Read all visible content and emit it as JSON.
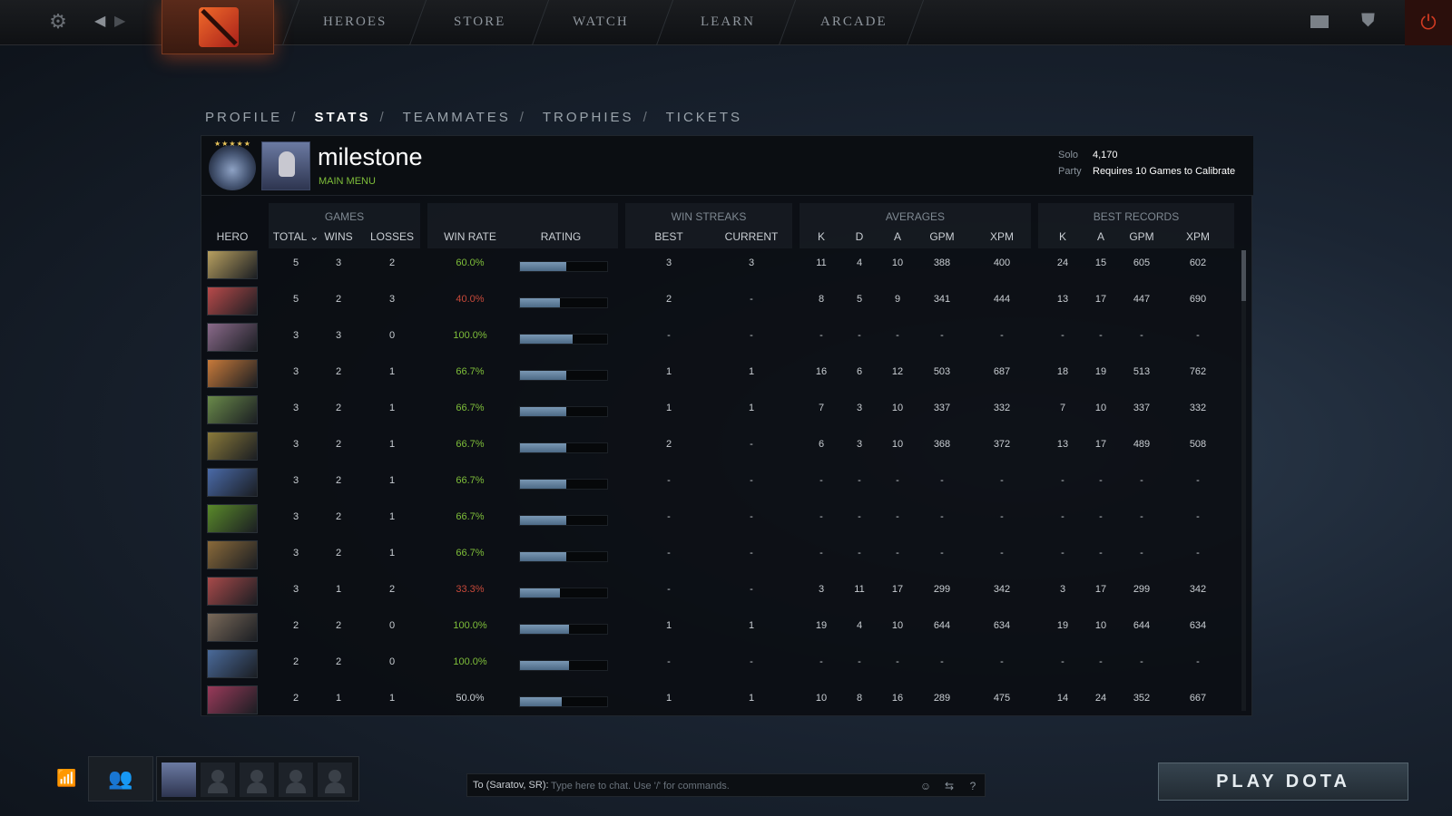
{
  "topbar": {
    "nav": [
      "HEROES",
      "STORE",
      "WATCH",
      "LEARN",
      "ARCADE"
    ],
    "icons": [
      "settings-gear-icon",
      "back-arrow-icon",
      "forward-arrow-icon",
      "mail-icon",
      "shield-icon",
      "power-icon"
    ]
  },
  "breadcrumb": [
    "PROFILE",
    "STATS",
    "TEAMMATES",
    "TROPHIES",
    "TICKETS"
  ],
  "breadcrumb_active": "STATS",
  "profile": {
    "name": "milestone",
    "subtitle": "MAIN MENU",
    "solo_label": "Solo",
    "solo_value": "4,170",
    "party_label": "Party",
    "party_value": "Requires 10 Games to Calibrate"
  },
  "table": {
    "groups": {
      "games": "GAMES",
      "streaks": "WIN STREAKS",
      "averages": "AVERAGES",
      "best": "BEST RECORDS"
    },
    "columns": {
      "hero": "HERO",
      "total": "TOTAL ⌄",
      "wins": "WINS",
      "losses": "LOSSES",
      "winrate": "WIN RATE",
      "rating": "RATING",
      "best": "BEST",
      "current": "CURRENT",
      "k": "K",
      "d": "D",
      "a": "A",
      "gpm": "GPM",
      "xpm": "XPM",
      "bk": "K",
      "ba": "A",
      "bgpm": "GPM",
      "bxpm": "XPM"
    },
    "rows": [
      {
        "total": "5",
        "wins": "3",
        "losses": "2",
        "winrate": "60.0%",
        "rating": 0.53,
        "best": "3",
        "current": "3",
        "k": "11",
        "d": "4",
        "a": "10",
        "gpm": "388",
        "xpm": "400",
        "bk": "24",
        "ba": "15",
        "bgpm": "605",
        "bxpm": "602",
        "color": "#b8a060"
      },
      {
        "total": "5",
        "wins": "2",
        "losses": "3",
        "winrate": "40.0%",
        "rating": 0.46,
        "best": "2",
        "current": "-",
        "k": "8",
        "d": "5",
        "a": "9",
        "gpm": "341",
        "xpm": "444",
        "bk": "13",
        "ba": "17",
        "bgpm": "447",
        "bxpm": "690",
        "color": "#b84a4a"
      },
      {
        "total": "3",
        "wins": "3",
        "losses": "0",
        "winrate": "100.0%",
        "rating": 0.6,
        "best": "-",
        "current": "-",
        "k": "-",
        "d": "-",
        "a": "-",
        "gpm": "-",
        "xpm": "-",
        "bk": "-",
        "ba": "-",
        "bgpm": "-",
        "bxpm": "-",
        "color": "#8a6a8a"
      },
      {
        "total": "3",
        "wins": "2",
        "losses": "1",
        "winrate": "66.7%",
        "rating": 0.53,
        "best": "1",
        "current": "1",
        "k": "16",
        "d": "6",
        "a": "12",
        "gpm": "503",
        "xpm": "687",
        "bk": "18",
        "ba": "19",
        "bgpm": "513",
        "bxpm": "762",
        "color": "#c87a3a"
      },
      {
        "total": "3",
        "wins": "2",
        "losses": "1",
        "winrate": "66.7%",
        "rating": 0.53,
        "best": "1",
        "current": "1",
        "k": "7",
        "d": "3",
        "a": "10",
        "gpm": "337",
        "xpm": "332",
        "bk": "7",
        "ba": "10",
        "bgpm": "337",
        "bxpm": "332",
        "color": "#6a8a4a"
      },
      {
        "total": "3",
        "wins": "2",
        "losses": "1",
        "winrate": "66.7%",
        "rating": 0.53,
        "best": "2",
        "current": "-",
        "k": "6",
        "d": "3",
        "a": "10",
        "gpm": "368",
        "xpm": "372",
        "bk": "13",
        "ba": "17",
        "bgpm": "489",
        "bxpm": "508",
        "color": "#8a7a3a"
      },
      {
        "total": "3",
        "wins": "2",
        "losses": "1",
        "winrate": "66.7%",
        "rating": 0.53,
        "best": "-",
        "current": "-",
        "k": "-",
        "d": "-",
        "a": "-",
        "gpm": "-",
        "xpm": "-",
        "bk": "-",
        "ba": "-",
        "bgpm": "-",
        "bxpm": "-",
        "color": "#4a6aa8"
      },
      {
        "total": "3",
        "wins": "2",
        "losses": "1",
        "winrate": "66.7%",
        "rating": 0.53,
        "best": "-",
        "current": "-",
        "k": "-",
        "d": "-",
        "a": "-",
        "gpm": "-",
        "xpm": "-",
        "bk": "-",
        "ba": "-",
        "bgpm": "-",
        "bxpm": "-",
        "color": "#5a8a2a"
      },
      {
        "total": "3",
        "wins": "2",
        "losses": "1",
        "winrate": "66.7%",
        "rating": 0.53,
        "best": "-",
        "current": "-",
        "k": "-",
        "d": "-",
        "a": "-",
        "gpm": "-",
        "xpm": "-",
        "bk": "-",
        "ba": "-",
        "bgpm": "-",
        "bxpm": "-",
        "color": "#8a6a3a"
      },
      {
        "total": "3",
        "wins": "1",
        "losses": "2",
        "winrate": "33.3%",
        "rating": 0.46,
        "best": "-",
        "current": "-",
        "k": "3",
        "d": "11",
        "a": "17",
        "gpm": "299",
        "xpm": "342",
        "bk": "3",
        "ba": "17",
        "bgpm": "299",
        "bxpm": "342",
        "color": "#a84a4a"
      },
      {
        "total": "2",
        "wins": "2",
        "losses": "0",
        "winrate": "100.0%",
        "rating": 0.56,
        "best": "1",
        "current": "1",
        "k": "19",
        "d": "4",
        "a": "10",
        "gpm": "644",
        "xpm": "634",
        "bk": "19",
        "ba": "10",
        "bgpm": "644",
        "bxpm": "634",
        "color": "#7a6a5a"
      },
      {
        "total": "2",
        "wins": "2",
        "losses": "0",
        "winrate": "100.0%",
        "rating": 0.56,
        "best": "-",
        "current": "-",
        "k": "-",
        "d": "-",
        "a": "-",
        "gpm": "-",
        "xpm": "-",
        "bk": "-",
        "ba": "-",
        "bgpm": "-",
        "bxpm": "-",
        "color": "#4a6a9a"
      },
      {
        "total": "2",
        "wins": "1",
        "losses": "1",
        "winrate": "50.0%",
        "rating": 0.48,
        "best": "1",
        "current": "1",
        "k": "10",
        "d": "8",
        "a": "16",
        "gpm": "289",
        "xpm": "475",
        "bk": "14",
        "ba": "24",
        "bgpm": "352",
        "bxpm": "667",
        "color": "#9a3a5a"
      }
    ]
  },
  "bottom": {
    "chat_to": "To (Saratov, SR):",
    "chat_placeholder": "Type here to chat. Use '/' for commands.",
    "chat_help": "?",
    "play_label": "PLAY DOTA"
  }
}
